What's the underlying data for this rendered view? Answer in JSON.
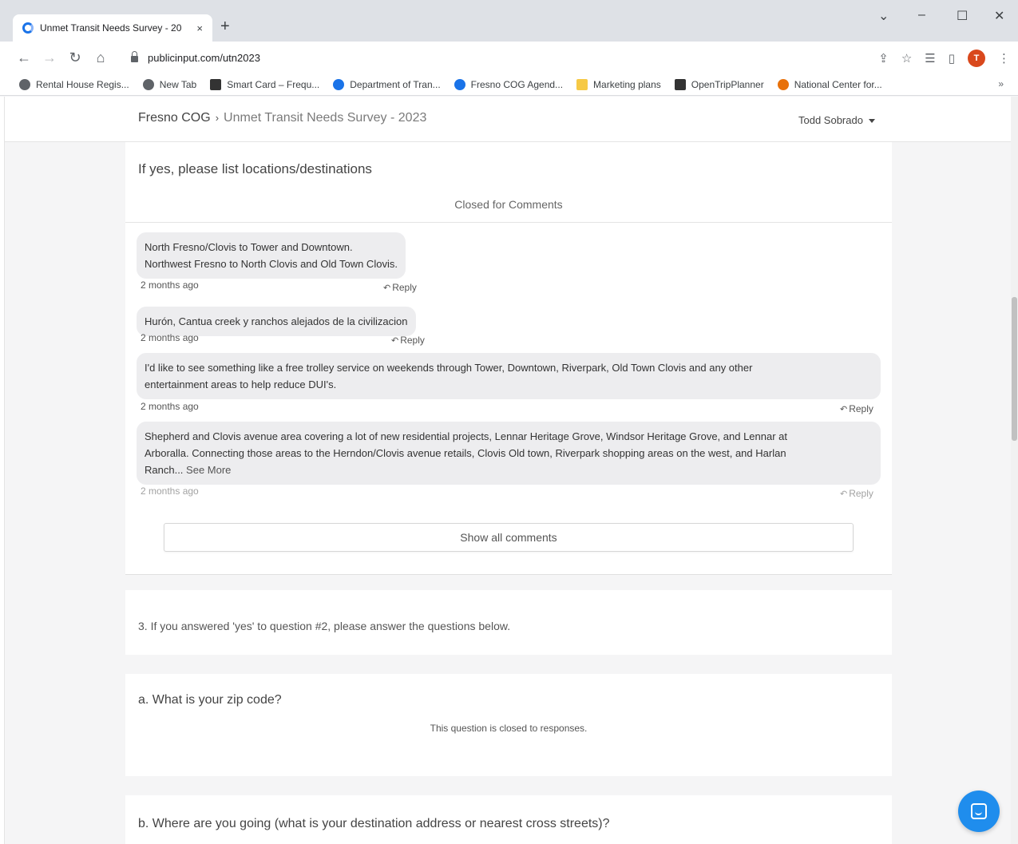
{
  "browser": {
    "tab_title": "Unmet Transit Needs Survey - 20",
    "tab_close": "×",
    "new_tab": "+",
    "url": "publicinput.com/utn2023",
    "profile_initial": "T",
    "window": {
      "chevron": "⌄",
      "minimize": "–",
      "maximize": "☐",
      "close": "✕"
    },
    "bookmarks": [
      {
        "label": "Rental House Regis...",
        "icon": "globe-icon"
      },
      {
        "label": "New Tab",
        "icon": "globe-icon"
      },
      {
        "label": "Smart Card – Frequ...",
        "icon": "r-logo-icon"
      },
      {
        "label": "Department of Tran...",
        "icon": "dot-logo-icon"
      },
      {
        "label": "Fresno COG Agend...",
        "icon": "fresno-cog-icon"
      },
      {
        "label": "Marketing plans",
        "icon": "folder-icon"
      },
      {
        "label": "OpenTripPlanner",
        "icon": "otp-icon"
      },
      {
        "label": "National Center for...",
        "icon": "nctr-icon"
      }
    ],
    "bookmarks_more": "»"
  },
  "site": {
    "breadcrumb_home": "Fresno COG",
    "breadcrumb_separator": "›",
    "breadcrumb_current": "Unmet Transit Needs Survey - 2023",
    "user_name": "Todd Sobrado"
  },
  "question_locations": {
    "title": "If yes, please list locations/destinations",
    "status": "Closed for Comments",
    "comments": [
      {
        "lines": [
          "North Fresno/Clovis to Tower and Downtown.",
          "Northwest Fresno to North Clovis and Old Town Clovis."
        ],
        "time": "2 months ago",
        "reply": "Reply"
      },
      {
        "lines": [
          "Hurón, Cantua creek y ranchos alejados de la civilizacion"
        ],
        "time": "2 months ago",
        "reply": "Reply"
      },
      {
        "lines": [
          "I'd like to see something like a free trolley service on weekends through Tower, Downtown, Riverpark, Old Town Clovis and any other",
          "entertainment areas to help reduce DUI's."
        ],
        "time": "2 months ago",
        "reply": "Reply"
      },
      {
        "lines": [
          "Shepherd and Clovis avenue area covering a lot of new residential projects, Lennar Heritage Grove, Windsor Heritage Grove, and Lennar at",
          "Arboralla. Connecting those areas to the Herndon/Clovis avenue retails, Clovis Old town, Riverpark shopping areas on the west, and Harlan",
          "Ranch..."
        ],
        "see_more": "See More",
        "time": "2 months ago",
        "reply": "Reply"
      }
    ],
    "show_all": "Show all comments"
  },
  "question_3": {
    "title": "3.  If you answered 'yes' to question #2, please answer the questions below."
  },
  "question_a": {
    "title": "a. What is your zip code?",
    "closed_text": "This question is closed to responses."
  },
  "question_b": {
    "title": "b. Where are you going (what is your destination address or nearest cross streets)?"
  }
}
